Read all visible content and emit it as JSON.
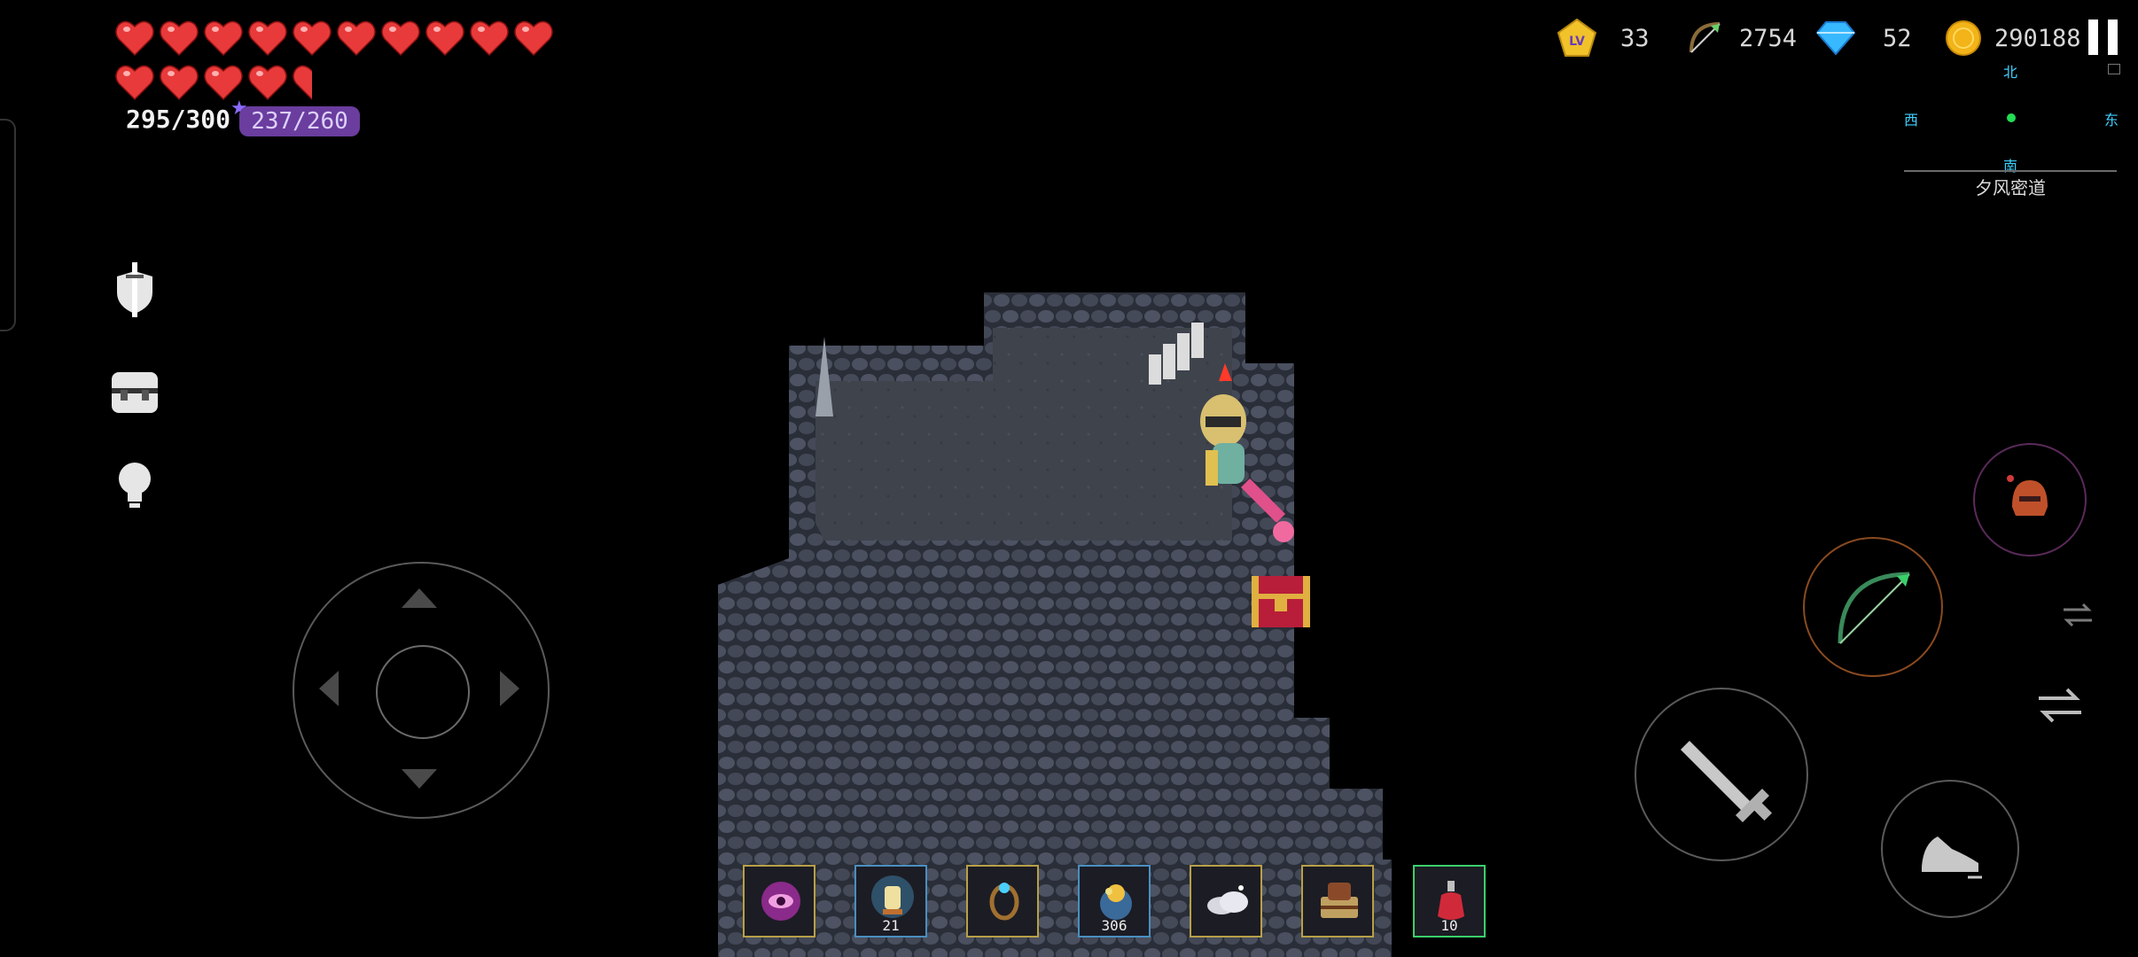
{
  "player": {
    "hearts_row1": 10,
    "hearts_row2_full": 4,
    "hearts_row2_half": 1,
    "hp": "295/300",
    "mp": "237/260"
  },
  "resources": {
    "level": "33",
    "arrows": "2754",
    "diamonds": "52",
    "gold": "290188"
  },
  "minimap": {
    "north": "北",
    "south": "南",
    "west": "西",
    "east": "东",
    "zone": "夕风密道"
  },
  "hotbar": [
    {
      "icon": "purple-eye-orb-icon",
      "count": "",
      "border": "#b8a048"
    },
    {
      "icon": "glowing-lantern-icon",
      "count": "21",
      "border": "#4a8fc0"
    },
    {
      "icon": "ring-icon",
      "count": "",
      "border": "#b8a048"
    },
    {
      "icon": "treasure-pot-icon",
      "count": "306",
      "border": "#4a8fc0"
    },
    {
      "icon": "cloud-icon",
      "count": "",
      "border": "#b8a048"
    },
    {
      "icon": "spellbook-icon",
      "count": "",
      "border": "#b8a048"
    },
    {
      "icon": "red-potion-icon",
      "count": "10",
      "border": "#3ad06a"
    }
  ],
  "colors": {
    "heart": "#e83a3a",
    "mp_pill": "#6a3d9e",
    "minimap_label": "#3fd1ff",
    "minimap_dot": "#22dd55",
    "bow_ring": "#8a4a20",
    "helmet_ring": "#5a2a5a"
  }
}
